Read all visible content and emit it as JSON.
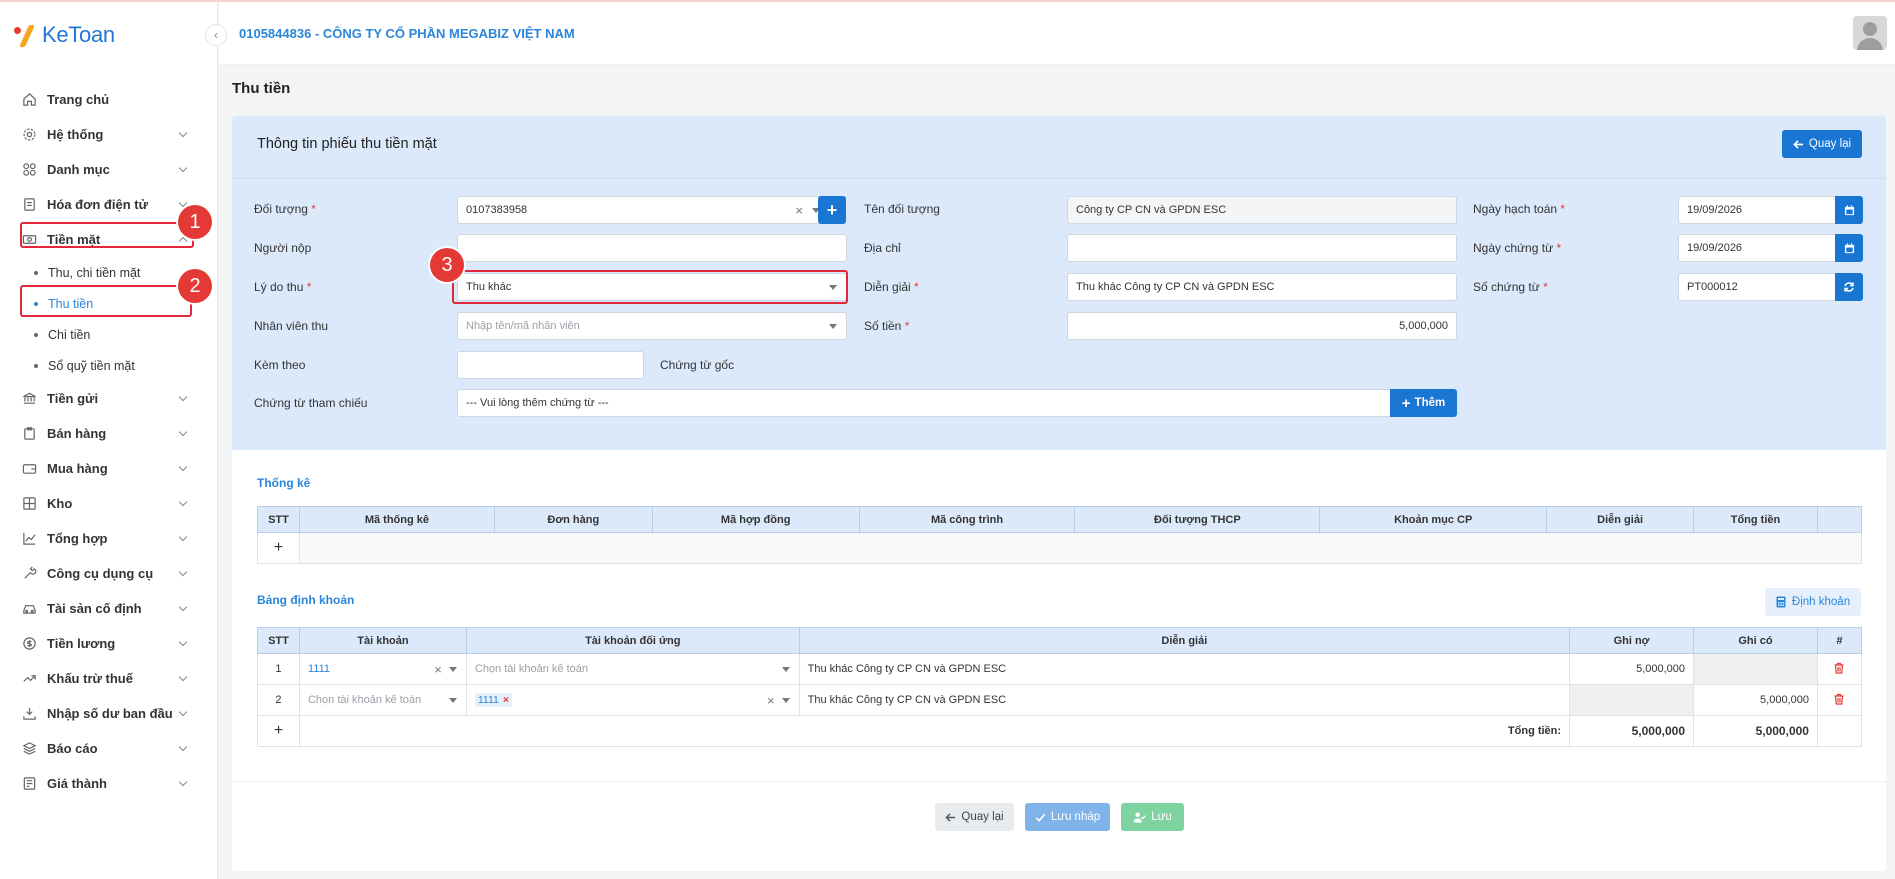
{
  "app": {
    "logo": "KeToan"
  },
  "header": {
    "company": "0105844836 - CÔNG TY CỔ PHẦN MEGABIZ VIỆT NAM"
  },
  "page": {
    "title": "Thu tiền"
  },
  "sidebar": {
    "items": [
      {
        "label": "Trang chủ",
        "icon": "home-icon"
      },
      {
        "label": "Hệ thống",
        "icon": "gear-icon"
      },
      {
        "label": "Danh mục",
        "icon": "grid-icon"
      },
      {
        "label": "Hóa đơn điện tử",
        "icon": "invoice-icon"
      },
      {
        "label": "Tiền mặt",
        "icon": "cash-icon"
      },
      {
        "label": "Tiền gửi",
        "icon": "bank-icon"
      },
      {
        "label": "Bán hàng",
        "icon": "sales-icon"
      },
      {
        "label": "Mua hàng",
        "icon": "purchase-icon"
      },
      {
        "label": "Kho",
        "icon": "warehouse-icon"
      },
      {
        "label": "Tổng hợp",
        "icon": "chart-icon"
      },
      {
        "label": "Công cụ dụng cụ",
        "icon": "tools-icon"
      },
      {
        "label": "Tài sản cố định",
        "icon": "asset-icon"
      },
      {
        "label": "Tiền lương",
        "icon": "salary-icon"
      },
      {
        "label": "Khấu trừ thuế",
        "icon": "tax-icon"
      },
      {
        "label": "Nhập số dư ban đầu",
        "icon": "balance-icon"
      },
      {
        "label": "Báo cáo",
        "icon": "report-icon"
      },
      {
        "label": "Giá thành",
        "icon": "cost-icon"
      }
    ],
    "sub_items": [
      "Thu, chi tiền mặt",
      "Thu tiền",
      "Chi tiền",
      "Sổ quỹ tiền mặt"
    ]
  },
  "form": {
    "section_title": "Thông tin phiếu thu tiền mặt",
    "back_top": "Quay lại",
    "doi_tuong": {
      "label": "Đối tượng",
      "value": "0107383958"
    },
    "ten_doi_tuong": {
      "label": "Tên đối tượng",
      "value": "Công ty CP CN và GPDN ESC"
    },
    "ngay_hach_toan": {
      "label": "Ngày hạch toán",
      "value": "19/09/2026"
    },
    "nguoi_nop": {
      "label": "Người nộp",
      "value": ""
    },
    "dia_chi": {
      "label": "Địa chỉ",
      "value": ""
    },
    "ngay_chung_tu": {
      "label": "Ngày chứng từ",
      "value": "19/09/2026"
    },
    "ly_do_thu": {
      "label": "Lý do thu",
      "value": "Thu khác"
    },
    "dien_giai": {
      "label": "Diễn giải",
      "value": "Thu khác Công ty CP CN và GPDN ESC"
    },
    "so_chung_tu": {
      "label": "Số chứng từ",
      "value": "PT000012"
    },
    "nhan_vien_thu": {
      "label": "Nhân viên thu",
      "placeholder": "Nhập tên/mã nhân viên"
    },
    "so_tien": {
      "label": "Số tiền",
      "value": "5,000,000"
    },
    "kem_theo": {
      "label": "Kèm theo",
      "value": ""
    },
    "chung_tu_goc": {
      "label": "Chứng từ gốc"
    },
    "chung_tu_tham_chieu": {
      "label": "Chứng từ tham chiếu",
      "placeholder": "--- Vui lòng thêm chứng từ ---"
    },
    "them_btn": "Thêm",
    "required_mark": "*"
  },
  "thong_ke": {
    "title": "Thống kê",
    "headers": [
      "STT",
      "Mã thống kê",
      "Đơn hàng",
      "Mã hợp đồng",
      "Mã công trình",
      "Đối tượng THCP",
      "Khoản mục CP",
      "Diễn giải",
      "Tổng tiền"
    ],
    "add": "+"
  },
  "dinh_khoan": {
    "title": "Bảng định khoản",
    "btn": "Định khoản",
    "headers": [
      "STT",
      "Tài khoản",
      "Tài khoản đối ứng",
      "Diễn giải",
      "Ghi nợ",
      "Ghi có",
      "#"
    ],
    "rows": [
      {
        "stt": "1",
        "tk": "1111",
        "tk_du_placeholder": "Chọn tài khoản kế toán",
        "dien_giai": "Thu khác Công ty CP CN và GPDN ESC",
        "ghi_no": "5,000,000",
        "ghi_co": ""
      },
      {
        "stt": "2",
        "tk_placeholder": "Chọn tài khoản kế toán",
        "tk_du": "1111",
        "dien_giai": "Thu khác Công ty CP CN và GPDN ESC",
        "ghi_no": "",
        "ghi_co": "5,000,000"
      }
    ],
    "total_label": "Tổng tiền:",
    "total_no": "5,000,000",
    "total_co": "5,000,000",
    "add": "+"
  },
  "footer": {
    "back": "Quay lại",
    "save_draft": "Lưu nháp",
    "save": "Lưu"
  },
  "annotations": [
    "1",
    "2",
    "3"
  ],
  "colors": {
    "primary": "#1976d2",
    "link": "#2b86d9",
    "annotation": "#e53935",
    "panel": "#dbe9fb"
  }
}
